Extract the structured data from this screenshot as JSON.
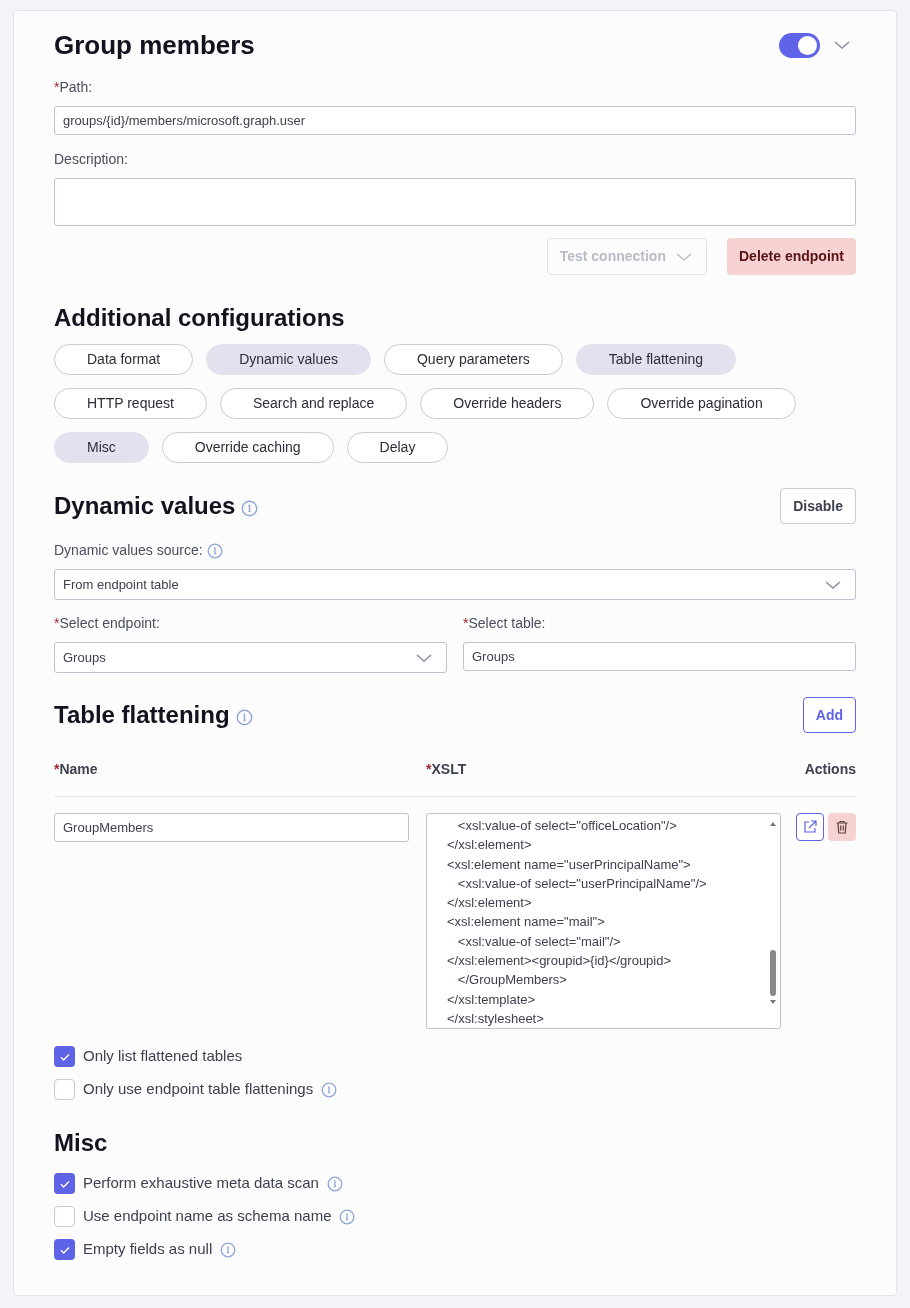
{
  "header": {
    "title": "Group members",
    "enabled": true
  },
  "path": {
    "mark": "*",
    "label": "Path:",
    "value": "groups/{id}/members/microsoft.graph.user"
  },
  "description": {
    "label": "Description:"
  },
  "actions": {
    "test": {
      "label": "Test connection",
      "disabled": true
    },
    "delete": {
      "label": "Delete endpoint"
    }
  },
  "additional": {
    "title": "Additional configurations",
    "rows": [
      [
        {
          "label": "Data format",
          "selected": false
        },
        {
          "label": "Dynamic values",
          "selected": true
        },
        {
          "label": "Query parameters",
          "selected": false
        },
        {
          "label": "Table flattening",
          "selected": true
        }
      ],
      [
        {
          "label": "HTTP request",
          "selected": false
        },
        {
          "label": "Search and replace",
          "selected": false
        },
        {
          "label": "Override headers",
          "selected": false
        },
        {
          "label": "Override pagination",
          "selected": false
        }
      ],
      [
        {
          "label": "Misc",
          "selected": true
        },
        {
          "label": "Override caching",
          "selected": false
        },
        {
          "label": "Delay",
          "selected": false
        }
      ]
    ]
  },
  "dynamic_values": {
    "title": "Dynamic values",
    "info": true,
    "button": "Disable",
    "source": {
      "label": "Dynamic values source:",
      "info": true,
      "value": "From endpoint table"
    },
    "endpoint": {
      "mark": "*",
      "label": "Select endpoint:",
      "value": "Groups"
    },
    "table": {
      "mark": "*",
      "label": "Select table:",
      "value": "Groups"
    }
  },
  "table_flattening": {
    "title": "Table flattening",
    "info": true,
    "button": "Add",
    "columns": [
      {
        "mark": "*",
        "label": "Name"
      },
      {
        "mark": "*",
        "label": "XSLT"
      },
      {
        "label": "Actions"
      }
    ],
    "rows": [
      {
        "name": "GroupMembers",
        "xslt": [
          "   <xsl:value-of select=\"officeLocation\"/>",
          "</xsl:element>",
          "<xsl:element name=\"userPrincipalName\">",
          "   <xsl:value-of select=\"userPrincipalName\"/>",
          "</xsl:element>",
          "<xsl:element name=\"mail\">",
          "   <xsl:value-of select=\"mail\"/>",
          "</xsl:element><groupid>{id}</groupid>",
          "   </GroupMembers>",
          "</xsl:template>",
          "</xsl:stylesheet>"
        ]
      }
    ],
    "options": [
      {
        "label": "Only list flattened tables",
        "checked": true,
        "info": false
      },
      {
        "label": "Only use endpoint table flattenings",
        "checked": false,
        "info": true
      }
    ]
  },
  "misc": {
    "title": "Misc",
    "options": [
      {
        "label": "Perform exhaustive meta data scan",
        "checked": true,
        "info": true
      },
      {
        "label": "Use endpoint name as schema name",
        "checked": false,
        "info": true
      },
      {
        "label": "Empty fields as null",
        "checked": true,
        "info": true
      }
    ]
  }
}
